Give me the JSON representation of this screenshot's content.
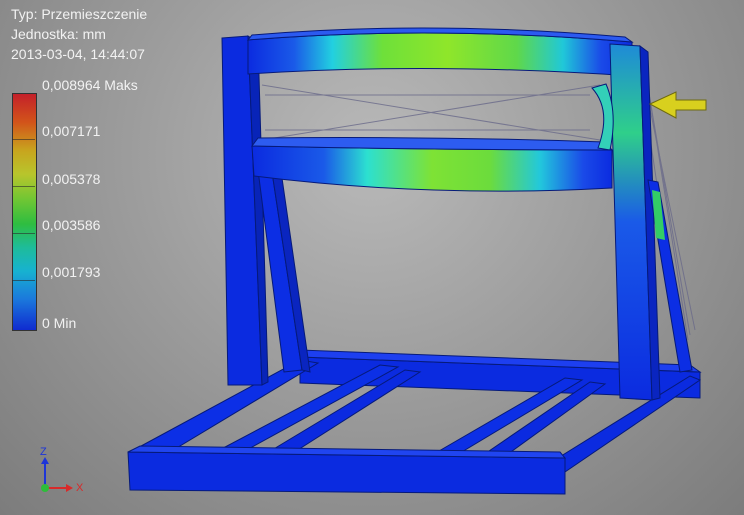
{
  "result_info": {
    "type_line": "Typ: Przemieszczenie",
    "unit_line": "Jednostka: mm",
    "timestamp_line": "2013-03-04, 14:44:07"
  },
  "legend": {
    "labels": [
      "0,008964 Maks",
      "0,007171",
      "0,005378",
      "0,003586",
      "0,001793",
      "0 Min"
    ],
    "colors": [
      "#c4202a",
      "#c8a51e",
      "#6ec634",
      "#1ebc9a",
      "#1b78dc",
      "#0f2bd0"
    ]
  },
  "model": {
    "base_color": "#0b2be0",
    "max_color": "#7fe22a",
    "load_arrow_color": "#c9c41a"
  },
  "axes": {
    "x_label": "X",
    "z_label": "Z"
  }
}
